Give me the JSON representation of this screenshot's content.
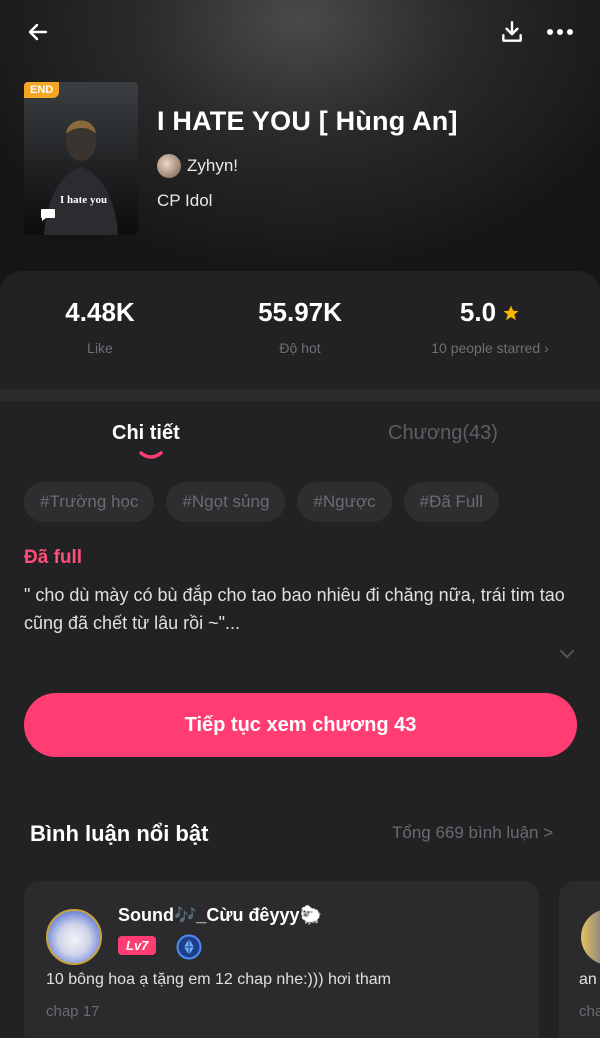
{
  "header": {
    "back_icon": "arrow-left-icon",
    "download_icon": "download-icon",
    "more_icon": "more-horizontal-icon"
  },
  "story": {
    "badge": "END",
    "cover_text": "I hate you",
    "title": "I HATE YOU [ Hùng An]",
    "author": "Zyhyn!",
    "category": "CP Idol"
  },
  "stats": {
    "likes": "4.48K",
    "likes_label": "Like",
    "hot": "55.97K",
    "hot_label": "Độ hot",
    "rating": "5.0",
    "rating_label": "10 people starred",
    "rating_arrow": "›"
  },
  "tabs": [
    {
      "label": "Chi tiết"
    },
    {
      "label": "Chương(43)"
    }
  ],
  "tags": [
    "#Trường học",
    "#Ngọt sủng",
    "#Ngược",
    "#Đã Full"
  ],
  "details": {
    "status": "Đã full",
    "description": "\" cho dù mày có bù đắp cho tao bao nhiêu đi chăng nữa, trái tim tao cũng đã chết từ lâu rồi ~\"..."
  },
  "cta": {
    "label": "Tiếp tục xem chương 43"
  },
  "comments": {
    "title": "Bình luận nổi bật",
    "total": "Tổng 669 bình luận >",
    "items": [
      {
        "user": "Sound🎶_Cừu đêyyy🐑",
        "level": "Lv7",
        "text": "10 bông hoa ạ tặng em 12 chap nhe:))) hơi tham",
        "chapter": "chap 17"
      },
      {
        "text": "an",
        "chapter": "cha"
      }
    ]
  },
  "colors": {
    "accent": "#ff3d72",
    "badge": "#f5a623",
    "star": "#f7b500"
  }
}
